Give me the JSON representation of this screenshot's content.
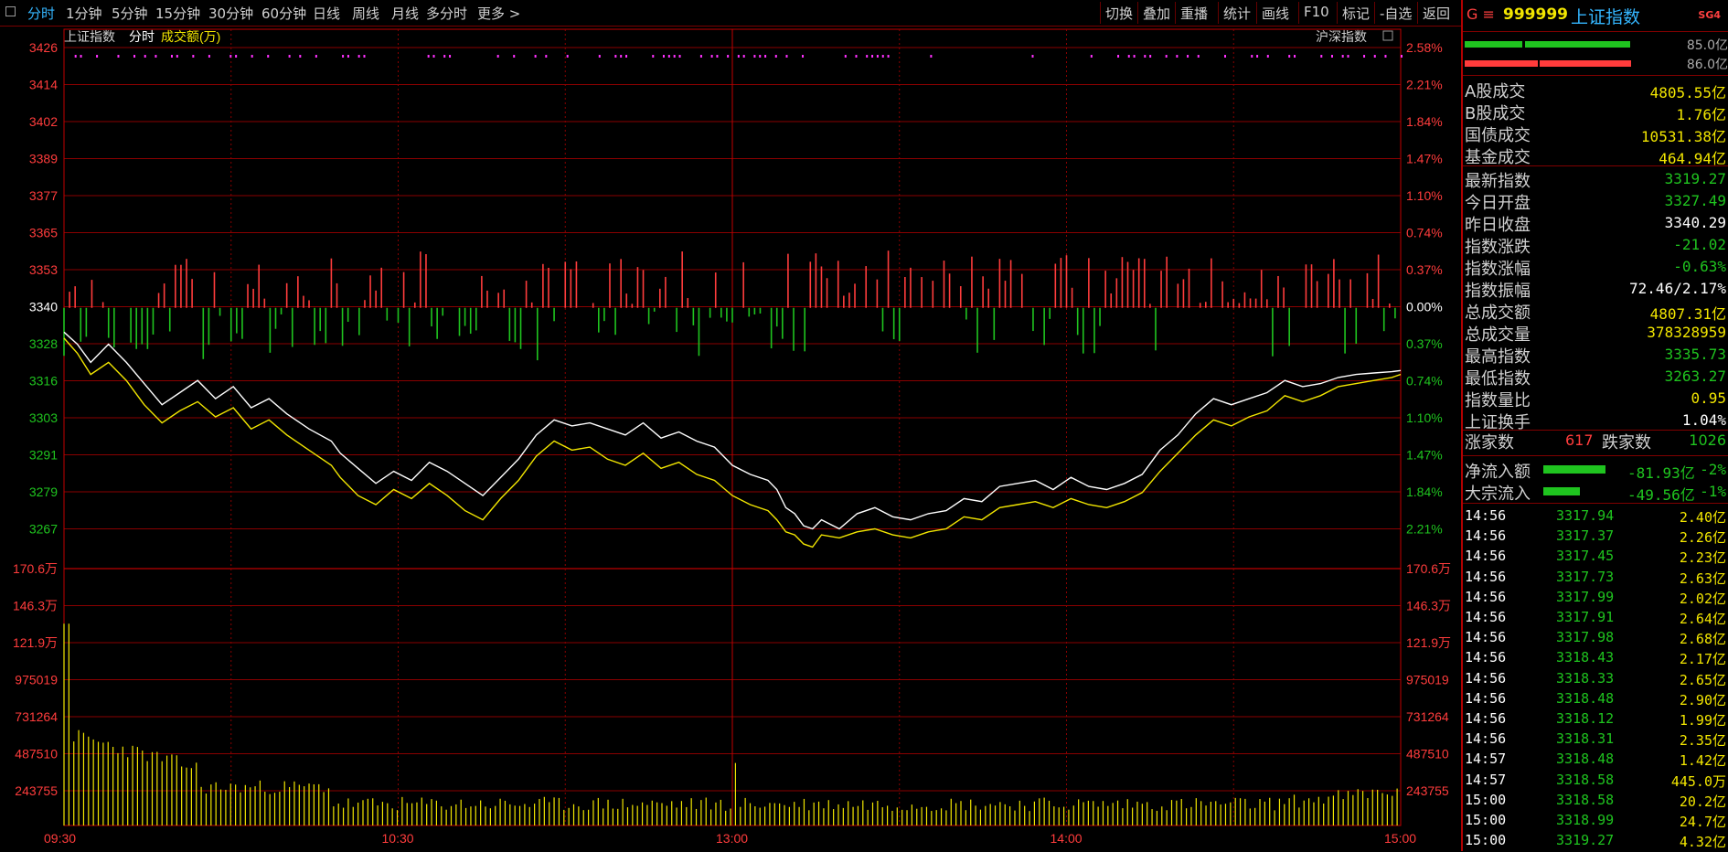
{
  "toolbar": {
    "tabs": [
      "分时",
      "1分钟",
      "5分钟",
      "15分钟",
      "30分钟",
      "60分钟",
      "日线",
      "周线",
      "月线",
      "多分时",
      "更多 >"
    ],
    "right_buttons": [
      "切换",
      "叠加",
      "重播",
      "统计",
      "画线",
      "F10",
      "标记",
      "-自选",
      "返回"
    ]
  },
  "chart_header": {
    "index_label": "上证指数",
    "mode_label": "分时",
    "volume_label": "成交额(万)",
    "compare_label": "沪深指数"
  },
  "colors": {
    "up": "#ff3c3c",
    "down": "#1fc41f",
    "price_line": "#ffffff",
    "avg_line": "#f2e600",
    "grid": "#8a0000",
    "accent": "#34b6ff"
  },
  "chart_data": {
    "type": "line",
    "x_labels": [
      "09:30",
      "10:30",
      "13:00",
      "14:00",
      "15:00"
    ],
    "prev_close": 3340.29,
    "price_axis": {
      "ticks": [
        3426,
        3414,
        3402,
        3389,
        3377,
        3365,
        3353,
        3340,
        3328,
        3316,
        3303,
        3291,
        3279,
        3267
      ],
      "ylim": [
        3263.5,
        3426
      ]
    },
    "pct_axis": [
      "2.58%",
      "2.21%",
      "1.84%",
      "1.47%",
      "1.10%",
      "0.74%",
      "0.37%",
      "0.00%",
      "0.37%",
      "0.74%",
      "1.10%",
      "1.47%",
      "1.84%",
      "2.21%"
    ],
    "volume_axis": {
      "ticks": [
        "170.6万",
        "146.3万",
        "121.9万",
        "975019",
        "731264",
        "487510",
        "243755"
      ]
    },
    "series": [
      {
        "name": "最新指数",
        "points": [
          [
            0,
            3332
          ],
          [
            3,
            3328
          ],
          [
            6,
            3322
          ],
          [
            10,
            3328
          ],
          [
            14,
            3322
          ],
          [
            18,
            3315
          ],
          [
            22,
            3308
          ],
          [
            26,
            3312
          ],
          [
            30,
            3316
          ],
          [
            34,
            3310
          ],
          [
            38,
            3314
          ],
          [
            42,
            3307
          ],
          [
            46,
            3310
          ],
          [
            50,
            3305
          ],
          [
            55,
            3300
          ],
          [
            60,
            3296
          ],
          [
            62,
            3292
          ],
          [
            66,
            3287
          ],
          [
            70,
            3282
          ],
          [
            74,
            3286
          ],
          [
            78,
            3283
          ],
          [
            82,
            3289
          ],
          [
            86,
            3286
          ],
          [
            90,
            3282
          ],
          [
            94,
            3278
          ],
          [
            98,
            3284
          ],
          [
            102,
            3290
          ],
          [
            106,
            3298
          ],
          [
            110,
            3303
          ],
          [
            114,
            3301
          ],
          [
            118,
            3302
          ],
          [
            122,
            3300
          ],
          [
            126,
            3298
          ],
          [
            130,
            3302
          ],
          [
            134,
            3297
          ],
          [
            138,
            3299
          ],
          [
            142,
            3296
          ],
          [
            146,
            3294
          ],
          [
            150,
            3288
          ],
          [
            154,
            3285
          ],
          [
            158,
            3283
          ],
          [
            160,
            3280
          ],
          [
            162,
            3274
          ],
          [
            164,
            3272
          ],
          [
            166,
            3268
          ],
          [
            168,
            3267
          ],
          [
            170,
            3270
          ],
          [
            174,
            3267
          ],
          [
            178,
            3272
          ],
          [
            182,
            3274
          ],
          [
            186,
            3271
          ],
          [
            190,
            3270
          ],
          [
            194,
            3272
          ],
          [
            198,
            3273
          ],
          [
            202,
            3277
          ],
          [
            206,
            3276
          ],
          [
            210,
            3281
          ],
          [
            214,
            3282
          ],
          [
            218,
            3283
          ],
          [
            222,
            3280
          ],
          [
            226,
            3284
          ],
          [
            230,
            3281
          ],
          [
            234,
            3280
          ],
          [
            238,
            3282
          ],
          [
            242,
            3285
          ],
          [
            246,
            3293
          ],
          [
            250,
            3298
          ],
          [
            254,
            3305
          ],
          [
            258,
            3310
          ],
          [
            262,
            3308
          ],
          [
            266,
            3310
          ],
          [
            270,
            3312
          ],
          [
            274,
            3316
          ],
          [
            278,
            3314
          ],
          [
            282,
            3315
          ],
          [
            286,
            3317
          ],
          [
            290,
            3318
          ],
          [
            294,
            3318.5
          ],
          [
            298,
            3318.9
          ],
          [
            300,
            3319.3
          ]
        ]
      },
      {
        "name": "均价",
        "points": [
          [
            0,
            3330
          ],
          [
            3,
            3325
          ],
          [
            6,
            3318
          ],
          [
            10,
            3322
          ],
          [
            14,
            3316
          ],
          [
            18,
            3308
          ],
          [
            22,
            3302
          ],
          [
            26,
            3306
          ],
          [
            30,
            3309
          ],
          [
            34,
            3304
          ],
          [
            38,
            3307
          ],
          [
            42,
            3300
          ],
          [
            46,
            3303
          ],
          [
            50,
            3298
          ],
          [
            55,
            3293
          ],
          [
            60,
            3288
          ],
          [
            62,
            3284
          ],
          [
            66,
            3278
          ],
          [
            70,
            3275
          ],
          [
            74,
            3280
          ],
          [
            78,
            3277
          ],
          [
            82,
            3282
          ],
          [
            86,
            3278
          ],
          [
            90,
            3273
          ],
          [
            94,
            3270
          ],
          [
            98,
            3277
          ],
          [
            102,
            3283
          ],
          [
            106,
            3291
          ],
          [
            110,
            3296
          ],
          [
            114,
            3293
          ],
          [
            118,
            3294
          ],
          [
            122,
            3290
          ],
          [
            126,
            3288
          ],
          [
            130,
            3292
          ],
          [
            134,
            3287
          ],
          [
            138,
            3289
          ],
          [
            142,
            3285
          ],
          [
            146,
            3283
          ],
          [
            150,
            3278
          ],
          [
            154,
            3275
          ],
          [
            158,
            3273
          ],
          [
            160,
            3270
          ],
          [
            162,
            3266
          ],
          [
            164,
            3265
          ],
          [
            166,
            3262
          ],
          [
            168,
            3261
          ],
          [
            170,
            3265
          ],
          [
            174,
            3264
          ],
          [
            178,
            3266
          ],
          [
            182,
            3267
          ],
          [
            186,
            3265
          ],
          [
            190,
            3264
          ],
          [
            194,
            3266
          ],
          [
            198,
            3267
          ],
          [
            202,
            3271
          ],
          [
            206,
            3270
          ],
          [
            210,
            3274
          ],
          [
            214,
            3275
          ],
          [
            218,
            3276
          ],
          [
            222,
            3274
          ],
          [
            226,
            3277
          ],
          [
            230,
            3275
          ],
          [
            234,
            3274
          ],
          [
            238,
            3276
          ],
          [
            242,
            3279
          ],
          [
            246,
            3286
          ],
          [
            250,
            3292
          ],
          [
            254,
            3298
          ],
          [
            258,
            3303
          ],
          [
            262,
            3301
          ],
          [
            266,
            3304
          ],
          [
            270,
            3306
          ],
          [
            274,
            3311
          ],
          [
            278,
            3309
          ],
          [
            282,
            3311
          ],
          [
            286,
            3314
          ],
          [
            290,
            3315
          ],
          [
            294,
            3316
          ],
          [
            298,
            3317
          ],
          [
            300,
            3318
          ]
        ]
      }
    ],
    "volume_peak": 1550000
  },
  "panel": {
    "header": {
      "prefix": "G  ≡",
      "code": "999999",
      "name": "上证指数",
      "tag": "SG4"
    },
    "ratios": [
      "85.0亿",
      "86.0亿"
    ],
    "stats": [
      {
        "label": "A股成交",
        "value": "4805.55亿",
        "color": "#f2e600"
      },
      {
        "label": "B股成交",
        "value": "1.76亿",
        "color": "#f2e600"
      },
      {
        "label": "国债成交",
        "value": "10531.38亿",
        "color": "#f2e600"
      },
      {
        "label": "基金成交",
        "value": "464.94亿",
        "color": "#f2e600"
      },
      {
        "label": "最新指数",
        "value": "3319.27",
        "color": "#1fc41f"
      },
      {
        "label": "今日开盘",
        "value": "3327.49",
        "color": "#1fc41f"
      },
      {
        "label": "昨日收盘",
        "value": "3340.29",
        "color": "#ffffff"
      },
      {
        "label": "指数涨跌",
        "value": "-21.02",
        "color": "#1fc41f"
      },
      {
        "label": "指数涨幅",
        "value": "-0.63%",
        "color": "#1fc41f"
      },
      {
        "label": "指数振幅",
        "value": "72.46/2.17%",
        "color": "#ffffff"
      },
      {
        "label": "总成交额",
        "value": "4807.31亿",
        "color": "#f2e600"
      },
      {
        "label": "总成交量",
        "value": "378328959",
        "color": "#f2e600"
      },
      {
        "label": "最高指数",
        "value": "3335.73",
        "color": "#1fc41f"
      },
      {
        "label": "最低指数",
        "value": "3263.27",
        "color": "#1fc41f"
      },
      {
        "label": "指数量比",
        "value": "0.95",
        "color": "#f2e600"
      },
      {
        "label": "上证换手",
        "value": "1.04%",
        "color": "#ffffff"
      }
    ],
    "breadth": {
      "up_label": "涨家数",
      "up_value": "617",
      "down_label": "跌家数",
      "down_value": "1026"
    },
    "flows": [
      {
        "label": "净流入额",
        "amount": "-81.93亿",
        "pct": "-2%"
      },
      {
        "label": "大宗流入",
        "amount": "-49.56亿",
        "pct": "-1%"
      }
    ],
    "ticks": [
      [
        "14:56",
        "3317.94",
        "2.40亿"
      ],
      [
        "14:56",
        "3317.37",
        "2.26亿"
      ],
      [
        "14:56",
        "3317.45",
        "2.23亿"
      ],
      [
        "14:56",
        "3317.73",
        "2.63亿"
      ],
      [
        "14:56",
        "3317.99",
        "2.02亿"
      ],
      [
        "14:56",
        "3317.91",
        "2.64亿"
      ],
      [
        "14:56",
        "3317.98",
        "2.68亿"
      ],
      [
        "14:56",
        "3318.43",
        "2.17亿"
      ],
      [
        "14:56",
        "3318.33",
        "2.65亿"
      ],
      [
        "14:56",
        "3318.48",
        "2.90亿"
      ],
      [
        "14:56",
        "3318.12",
        "1.99亿"
      ],
      [
        "14:56",
        "3318.31",
        "2.35亿"
      ],
      [
        "14:57",
        "3318.48",
        "1.42亿"
      ],
      [
        "14:57",
        "3318.58",
        "445.0万"
      ],
      [
        "15:00",
        "3318.58",
        "20.2亿"
      ],
      [
        "15:00",
        "3318.99",
        "24.7亿"
      ],
      [
        "15:00",
        "3319.27",
        "4.32亿"
      ]
    ]
  }
}
